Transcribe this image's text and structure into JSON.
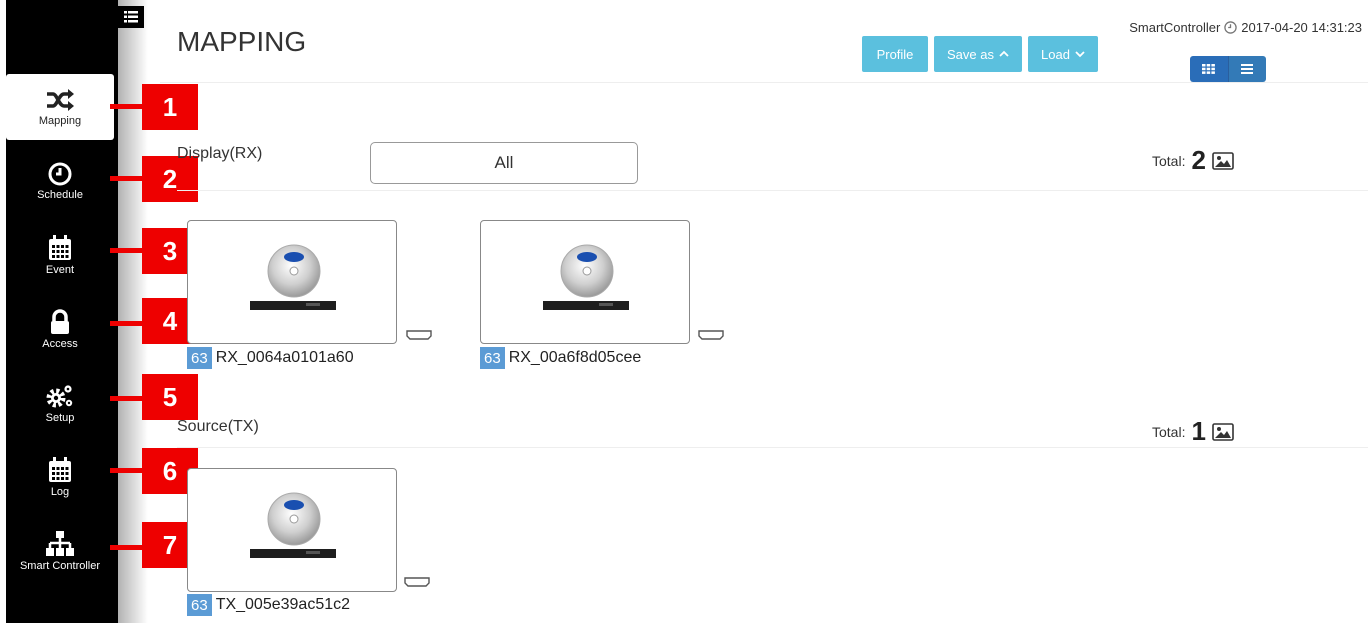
{
  "sidebar": {
    "items": [
      {
        "label": "Mapping",
        "icon": "shuffle-icon",
        "active": true
      },
      {
        "label": "Schedule",
        "icon": "clock-icon"
      },
      {
        "label": "Event",
        "icon": "calendar-icon"
      },
      {
        "label": "Access",
        "icon": "lock-icon"
      },
      {
        "label": "Setup",
        "icon": "gears-icon"
      },
      {
        "label": "Log",
        "icon": "calendar-icon"
      },
      {
        "label": "Smart Controller",
        "icon": "sitemap-icon"
      }
    ]
  },
  "callouts": [
    "1",
    "2",
    "3",
    "4",
    "5",
    "6",
    "7"
  ],
  "header": {
    "title": "MAPPING",
    "buttons": {
      "profile": "Profile",
      "save_as": "Save as",
      "load": "Load"
    },
    "device_name": "SmartController",
    "datetime": "2017-04-20 14:31:23"
  },
  "display": {
    "label": "Display(RX)",
    "filter": "All",
    "total_label": "Total:",
    "total": "2",
    "devices": [
      {
        "badge": "63",
        "name": "RX_0064a0101a60"
      },
      {
        "badge": "63",
        "name": "RX_00a6f8d05cee"
      }
    ]
  },
  "source": {
    "label": "Source(TX)",
    "total_label": "Total:",
    "total": "1",
    "devices": [
      {
        "badge": "63",
        "name": "TX_005e39ac51c2"
      }
    ]
  },
  "colors": {
    "accent": "#5bc0de",
    "primary": "#337ab7",
    "badge": "#5b9bd5",
    "callout": "#ee0000"
  }
}
